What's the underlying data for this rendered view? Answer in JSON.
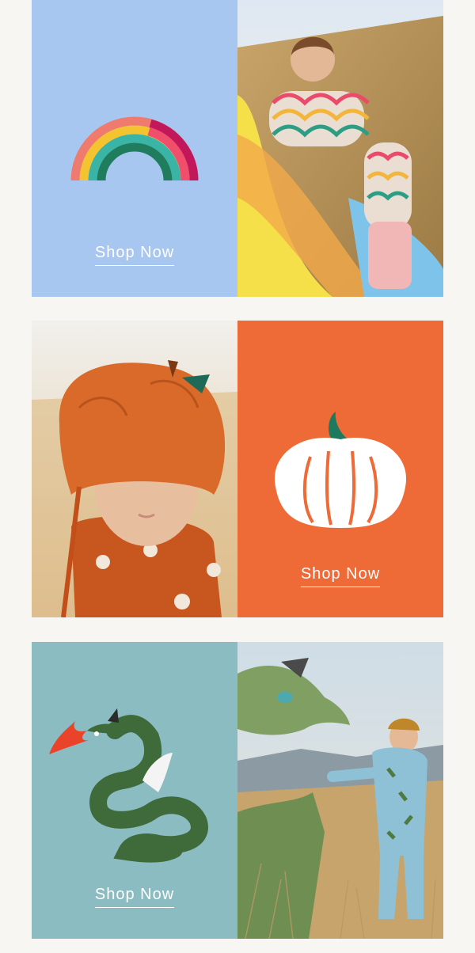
{
  "colors": {
    "page_bg": "#f8f6f3",
    "rainbow_tile": "#a8c7f0",
    "pumpkin_tile": "#ee6a37",
    "dragon_tile": "#8bbcc2"
  },
  "promos": [
    {
      "icon": "rainbow-icon",
      "cta": "Shop Now",
      "photo": "child-in-rainbow-pajamas-photo"
    },
    {
      "icon": "pumpkin-icon",
      "cta": "Shop Now",
      "photo": "baby-in-pumpkin-hat-photo"
    },
    {
      "icon": "dragon-icon",
      "cta": "Shop Now",
      "photo": "boy-with-dragon-costume-photo"
    }
  ]
}
